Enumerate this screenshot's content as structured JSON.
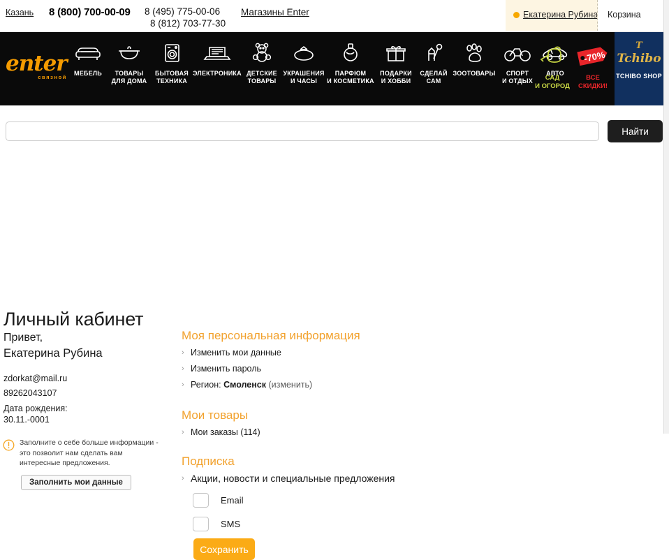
{
  "topbar": {
    "city": "Казань",
    "phone_main": "8 (800) 700-00-09",
    "phone_secondary_1": "8 (495) 775-00-06",
    "phone_secondary_2": "8 (812) 703-77-30",
    "shops_link": "Магазины Enter",
    "user_name": "Екатерина Рубина",
    "cart": "Корзина"
  },
  "nav": {
    "logo_text": "enter",
    "logo_sub": "связной",
    "items": [
      {
        "label": "МЕБЕЛЬ",
        "icon": "sofa-icon"
      },
      {
        "label": "ТОВАРЫ\nДЛЯ ДОМА",
        "icon": "pot-icon"
      },
      {
        "label": "БЫТОВАЯ\nТЕХНИКА",
        "icon": "washing-machine-icon"
      },
      {
        "label": "ЭЛЕКТРОНИКА",
        "icon": "laptop-icon"
      },
      {
        "label": "ДЕТСКИЕ\nТОВАРЫ",
        "icon": "teddy-bear-icon"
      },
      {
        "label": "УКРАШЕНИЯ\nИ ЧАСЫ",
        "icon": "ring-icon"
      },
      {
        "label": "ПАРФЮМ\nИ КОСМЕТИКА",
        "icon": "perfume-icon"
      },
      {
        "label": "ПОДАРКИ\nИ ХОББИ",
        "icon": "gift-icon"
      },
      {
        "label": "СДЕЛАЙ\nСАМ",
        "icon": "tools-icon"
      },
      {
        "label": "ЗООТОВАРЫ",
        "icon": "paw-icon"
      },
      {
        "label": "СПОРТ\nИ ОТДЫХ",
        "icon": "bicycle-icon"
      },
      {
        "label": "АВТО",
        "icon": "car-icon"
      }
    ],
    "promos": [
      {
        "label": "САД\nИ ОГОРОД",
        "icon": "watering-can-icon",
        "color": "#c9d744"
      },
      {
        "label": "ВСЕ\nСКИДКИ!",
        "icon": "discount-tag-icon",
        "color": "#e8252a",
        "badge": "-70%"
      }
    ],
    "tchibo": {
      "mark": "T",
      "word": "Tchibo",
      "shop": "TCHIBO SHOP",
      "bg": "#11305f"
    }
  },
  "search": {
    "value": "",
    "placeholder": "",
    "button_label": "Найти"
  },
  "main": {
    "page_title": "Личный кабинет",
    "greeting_line1": "Привет,",
    "greeting_line2": "Екатерина Рубина",
    "email": "zdorkat@mail.ru",
    "phone": "89262043107",
    "birthdate_label": "Дата рождения:",
    "birthdate_value": "30.11.-0001",
    "notice_text": "Заполните о себе больше информации - это позволит нам сделать вам интересные предложения.",
    "fill_button": "Заполнить мои данные",
    "sections": [
      {
        "title": "Моя персональная информация",
        "items": [
          {
            "text": "Изменить мои данные"
          },
          {
            "text": "Изменить пароль"
          },
          {
            "prefix": "Регион: ",
            "bold": "Смоленск",
            "suffix": " (изменить)"
          }
        ]
      },
      {
        "title": "Мои товары",
        "items": [
          {
            "text": "Мои заказы (114)"
          }
        ]
      },
      {
        "title": "Подписка",
        "items": [
          {
            "text": "Акции, новости и специальные предложения"
          }
        ]
      }
    ],
    "subscription_options": [
      {
        "label": "Email",
        "checked": false
      },
      {
        "label": "SMS",
        "checked": false
      }
    ],
    "save_button": "Сохранить"
  },
  "colors": {
    "brand_orange": "#f59b00",
    "heading_orange": "#f2a22e",
    "save_button": "#fbab16",
    "nav_bg": "#0a0a0a",
    "tchibo_blue": "#11305f",
    "sale_red": "#e8252a",
    "garden_green": "#c9d744"
  }
}
